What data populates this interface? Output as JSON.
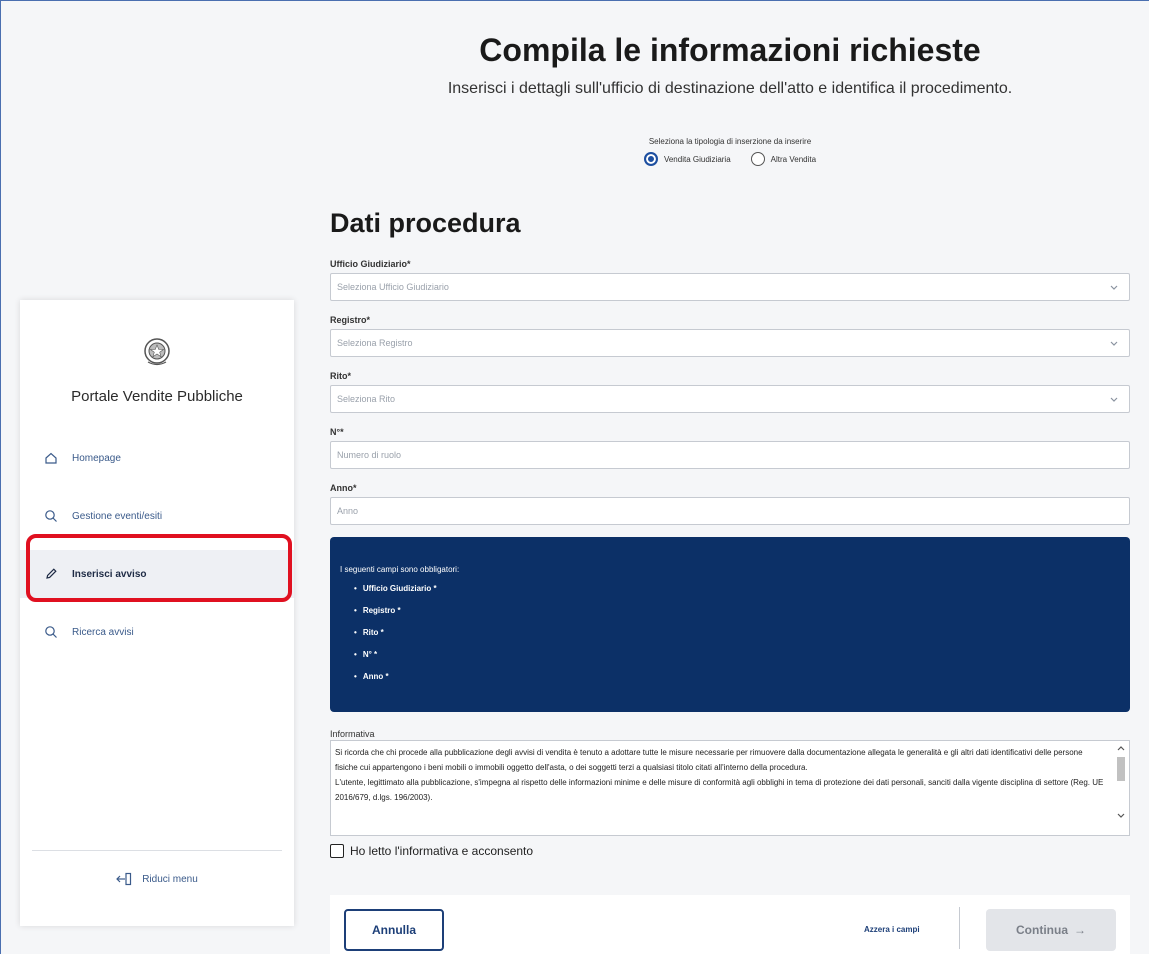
{
  "header": {
    "title": "Compila le informazioni richieste",
    "subtitle": "Inserisci i dettagli sull'ufficio di destinazione dell'atto e identifica il procedimento."
  },
  "insertion_type": {
    "label": "Seleziona la tipologia di inserzione da inserire",
    "options": [
      "Vendita Giudiziaria",
      "Altra Vendita"
    ],
    "selected": "Vendita Giudiziaria"
  },
  "sidebar": {
    "portal_title": "Portale Vendite Pubbliche",
    "items": [
      {
        "label": "Homepage",
        "icon": "home-icon"
      },
      {
        "label": "Gestione eventi/esiti",
        "icon": "search-icon"
      },
      {
        "label": "Inserisci avviso",
        "icon": "pencil-icon",
        "active": true
      },
      {
        "label": "Ricerca avvisi",
        "icon": "search-icon"
      }
    ],
    "reduce_menu": "Riduci menu",
    "highlight_color": "#e01020"
  },
  "form": {
    "section_title": "Dati procedura",
    "fields": [
      {
        "label": "Ufficio Giudiziario*",
        "placeholder": "Seleziona Ufficio Giudiziario",
        "type": "select"
      },
      {
        "label": "Registro*",
        "placeholder": "Seleziona Registro",
        "type": "select"
      },
      {
        "label": "Rito*",
        "placeholder": "Seleziona Rito",
        "type": "select"
      },
      {
        "label": "N°*",
        "placeholder": "Numero di ruolo",
        "type": "text"
      },
      {
        "label": "Anno*",
        "placeholder": "Anno",
        "type": "text"
      }
    ]
  },
  "required_box": {
    "intro": "I seguenti campi sono obbligatori:",
    "items": [
      "Ufficio Giudiziario *",
      "Registro *",
      "Rito *",
      "N° *",
      "Anno *"
    ],
    "background": "#0c3067"
  },
  "informativa": {
    "label": "Informativa",
    "paragraph1": "Si ricorda che chi procede alla pubblicazione degli avvisi di vendita è tenuto a adottare tutte le misure necessarie per rimuovere dalla documentazione allegata le generalità e gli altri dati identificativi delle persone fisiche cui appartengono i beni mobili o immobili oggetto dell'asta, o dei soggetti terzi a qualsiasi titolo citati all'interno della procedura.",
    "paragraph2": "L'utente, legittimato alla pubblicazione, s'impegna al rispetto delle informazioni minime e delle misure di conformità agli obblighi in tema di protezione dei dati personali, sanciti dalla vigente disciplina di settore (Reg. UE 2016/679, d.lgs. 196/2003)."
  },
  "consent": {
    "label": "Ho letto l'informativa e acconsento"
  },
  "footer": {
    "cancel": "Annulla",
    "reset": "Azzera i campi",
    "continue": "Continua",
    "continue_arrow": "→"
  }
}
